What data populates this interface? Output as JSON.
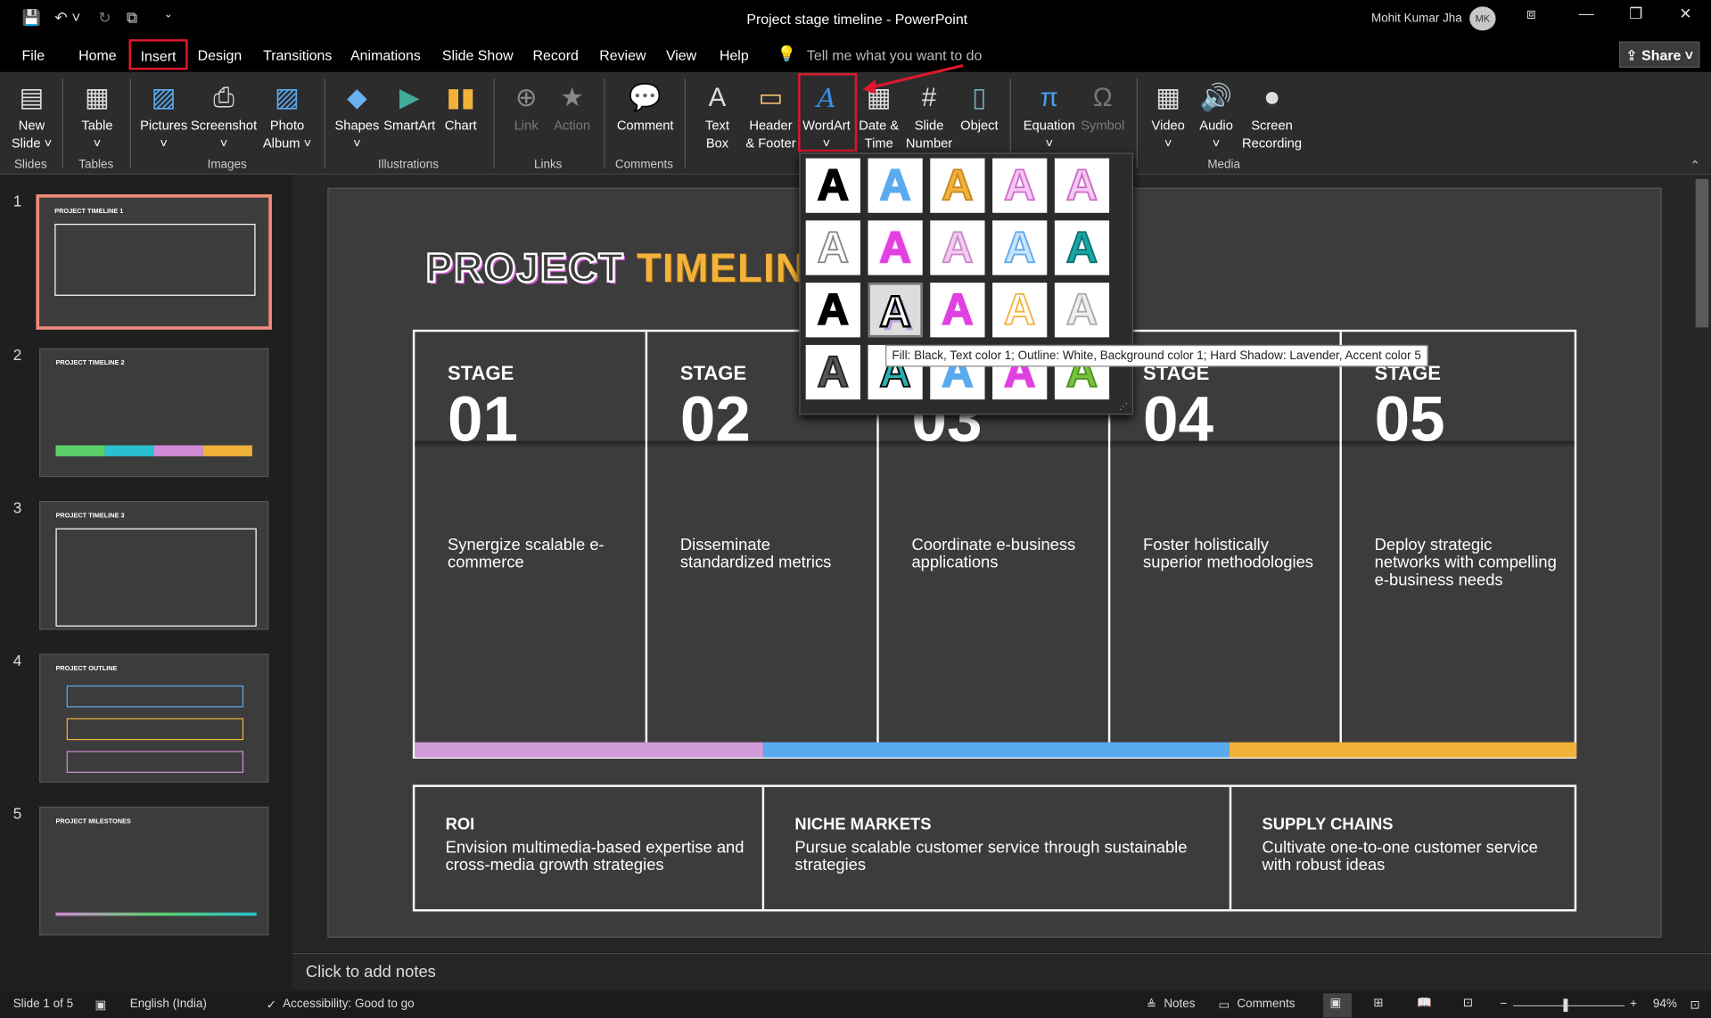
{
  "window": {
    "title": "Project stage timeline  -  PowerPoint",
    "user": "Mohit Kumar Jha",
    "initials": "MK",
    "share": "Share"
  },
  "tabs": [
    "File",
    "Home",
    "Insert",
    "Design",
    "Transitions",
    "Animations",
    "Slide Show",
    "Record",
    "Review",
    "View",
    "Help"
  ],
  "tellme": "Tell me what you want to do",
  "ribbon": {
    "buttons": [
      {
        "l1": "New",
        "l2": "Slide ˅",
        "icon": "new-slide-icon"
      },
      {
        "l1": "Table",
        "l2": "˅",
        "icon": "table-icon"
      },
      {
        "l1": "Pictures",
        "l2": "˅",
        "icon": "pictures-icon"
      },
      {
        "l1": "Screenshot",
        "l2": "˅",
        "icon": "screenshot-icon"
      },
      {
        "l1": "Photo",
        "l2": "Album ˅",
        "icon": "photo-album-icon"
      },
      {
        "l1": "Shapes",
        "l2": "˅",
        "icon": "shapes-icon"
      },
      {
        "l1": "SmartArt",
        "l2": "",
        "icon": "smartart-icon"
      },
      {
        "l1": "Chart",
        "l2": "",
        "icon": "chart-icon"
      },
      {
        "l1": "Link",
        "l2": "",
        "icon": "link-icon"
      },
      {
        "l1": "Action",
        "l2": "",
        "icon": "action-icon"
      },
      {
        "l1": "Comment",
        "l2": "",
        "icon": "comment-icon"
      },
      {
        "l1": "Text",
        "l2": "Box",
        "icon": "text-box-icon"
      },
      {
        "l1": "Header",
        "l2": "& Footer",
        "icon": "header-footer-icon"
      },
      {
        "l1": "WordArt",
        "l2": "˅",
        "icon": "wordart-icon"
      },
      {
        "l1": "Date &",
        "l2": "Time",
        "icon": "date-time-icon"
      },
      {
        "l1": "Slide",
        "l2": "Number",
        "icon": "slide-number-icon"
      },
      {
        "l1": "Object",
        "l2": "",
        "icon": "object-icon"
      },
      {
        "l1": "Equation",
        "l2": "˅",
        "icon": "equation-icon"
      },
      {
        "l1": "Symbol",
        "l2": "",
        "icon": "symbol-icon"
      },
      {
        "l1": "Video",
        "l2": "˅",
        "icon": "video-icon"
      },
      {
        "l1": "Audio",
        "l2": "˅",
        "icon": "audio-icon"
      },
      {
        "l1": "Screen",
        "l2": "Recording",
        "icon": "screen-recording-icon"
      }
    ],
    "groups": [
      "Slides",
      "Tables",
      "Images",
      "Illustrations",
      "Links",
      "Comments",
      "Media"
    ]
  },
  "thumbnails": [
    {
      "num": "1",
      "title": "PROJECT TIMELINE 1"
    },
    {
      "num": "2",
      "title": "PROJECT TIMELINE 2"
    },
    {
      "num": "3",
      "title": "PROJECT TIMELINE 3"
    },
    {
      "num": "4",
      "title": "PROJECT OUTLINE"
    },
    {
      "num": "5",
      "title": "PROJECT MILESTONES"
    }
  ],
  "slide": {
    "title_part1": "PROJECT ",
    "title_part2": "TIMELINE",
    "stage_label": "STAGE",
    "stages": [
      {
        "num": "01",
        "text": "Synergize scalable e-commerce"
      },
      {
        "num": "02",
        "text": "Disseminate standardized metrics"
      },
      {
        "num": "03",
        "text": "Coordinate e-business applications"
      },
      {
        "num": "04",
        "text": "Foster holistically superior methodologies"
      },
      {
        "num": "05",
        "text": "Deploy strategic networks with compelling e-business needs"
      }
    ],
    "bottom": [
      {
        "head": "ROI",
        "text": "Envision multimedia-based expertise and cross-media growth strategies"
      },
      {
        "head": "NICHE MARKETS",
        "text": "Pursue scalable customer service through sustainable strategies"
      },
      {
        "head": "SUPPLY CHAINS",
        "text": "Cultivate one-to-one customer service with robust ideas"
      }
    ],
    "bar_colors": [
      "#d19bd9",
      "#5aaaef",
      "#f2b13a"
    ]
  },
  "tooltip": "Fill: Black, Text color 1; Outline: White, Background color 1; Hard Shadow: Lavender, Accent color 5",
  "notes": "Click to add notes",
  "status": {
    "slide": "Slide 1 of 5",
    "language": "English (India)",
    "accessibility": "Accessibility: Good to go",
    "notes": "Notes",
    "comments": "Comments",
    "zoom": "94%"
  }
}
